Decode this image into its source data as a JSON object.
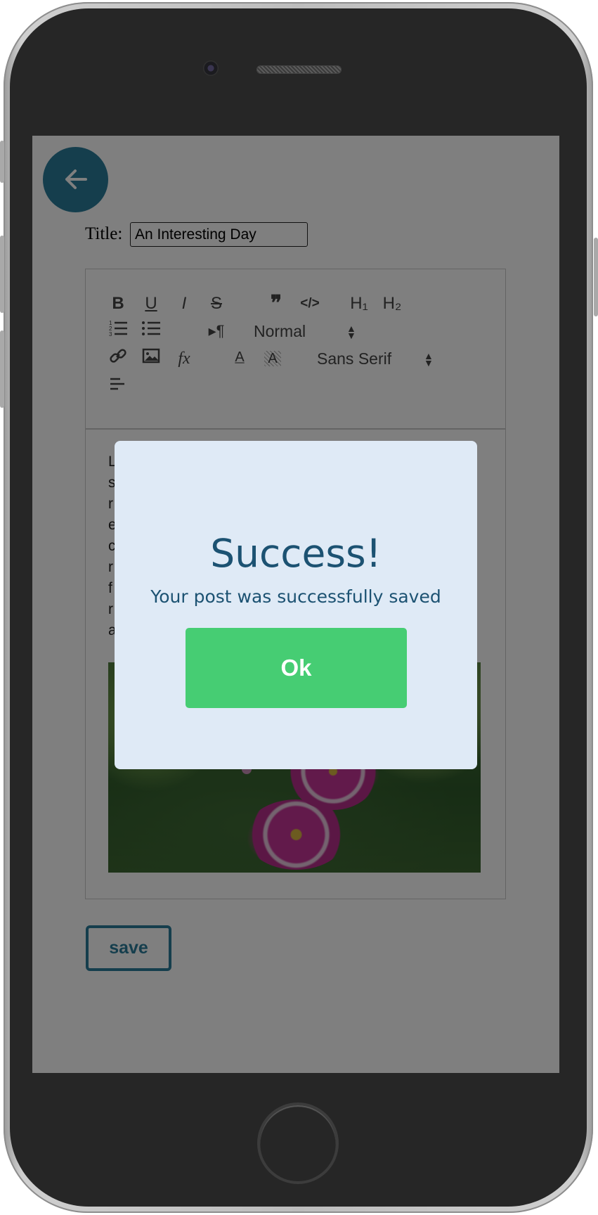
{
  "header": {
    "back_icon": "arrow-left-icon"
  },
  "form": {
    "title_label": "Title:",
    "title_value": "An Interesting Day"
  },
  "toolbar": {
    "bold": "B",
    "underline": "U",
    "italic": "I",
    "strike": "S",
    "blockquote": "❞",
    "code": "</>",
    "h1": "H₁",
    "h2": "H₂",
    "ordered_list_icon": "ordered-list-icon",
    "bullet_list_icon": "bullet-list-icon",
    "direction": "▸¶",
    "size_select": "Normal",
    "link_icon": "link-icon",
    "image_icon": "image-icon",
    "formula": "fx",
    "color": "A",
    "background": "A",
    "font_select": "Sans Serif",
    "align_icon": "align-left-icon"
  },
  "editor": {
    "text_lines": [
      "L",
      "s",
      "r",
      "e",
      "c",
      "r",
      "f",
      "r",
      "a"
    ],
    "image_icon": "flower-photo"
  },
  "actions": {
    "save_label": "save"
  },
  "modal": {
    "title": "Success!",
    "message": "Your post was successfully saved",
    "ok_label": "Ok"
  },
  "colors": {
    "accent": "#2b7d9b",
    "success": "#46cd73",
    "modal_bg": "#dfeaf6",
    "modal_text": "#1c5272"
  }
}
